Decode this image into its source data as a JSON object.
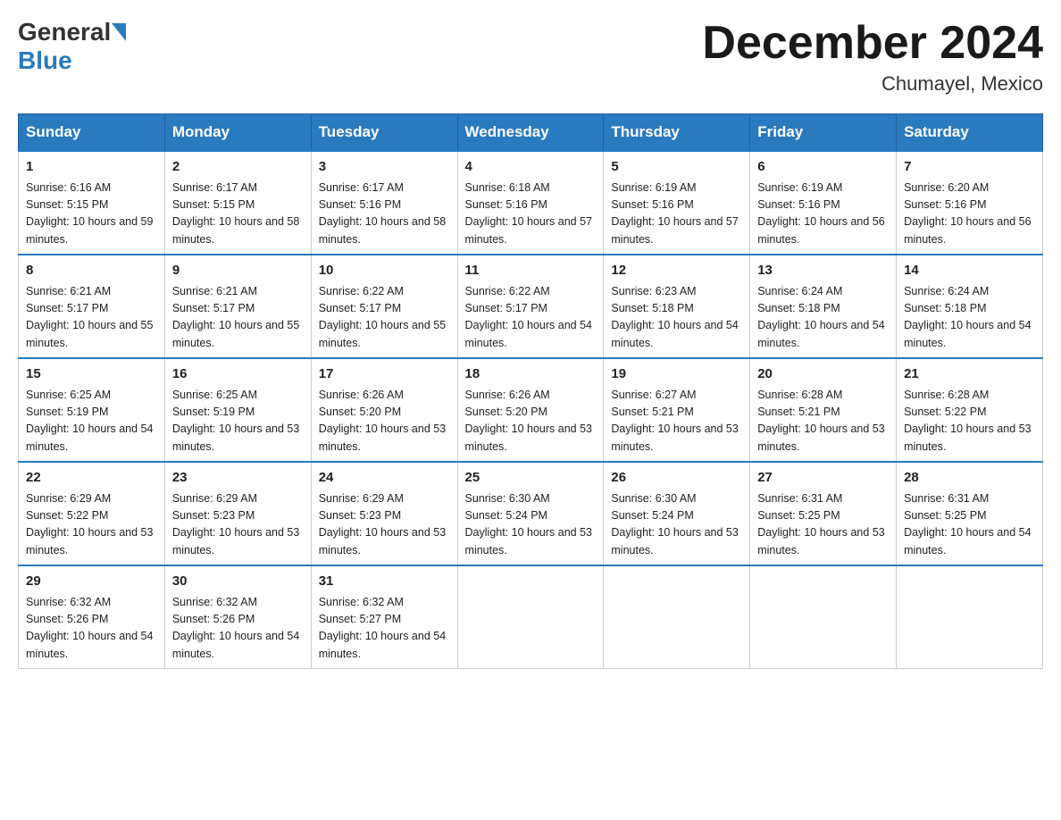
{
  "header": {
    "logo": {
      "general": "General",
      "blue": "Blue"
    },
    "title": "December 2024",
    "location": "Chumayel, Mexico"
  },
  "days_of_week": [
    "Sunday",
    "Monday",
    "Tuesday",
    "Wednesday",
    "Thursday",
    "Friday",
    "Saturday"
  ],
  "weeks": [
    [
      {
        "day": "1",
        "sunrise": "6:16 AM",
        "sunset": "5:15 PM",
        "daylight": "10 hours and 59 minutes."
      },
      {
        "day": "2",
        "sunrise": "6:17 AM",
        "sunset": "5:15 PM",
        "daylight": "10 hours and 58 minutes."
      },
      {
        "day": "3",
        "sunrise": "6:17 AM",
        "sunset": "5:16 PM",
        "daylight": "10 hours and 58 minutes."
      },
      {
        "day": "4",
        "sunrise": "6:18 AM",
        "sunset": "5:16 PM",
        "daylight": "10 hours and 57 minutes."
      },
      {
        "day": "5",
        "sunrise": "6:19 AM",
        "sunset": "5:16 PM",
        "daylight": "10 hours and 57 minutes."
      },
      {
        "day": "6",
        "sunrise": "6:19 AM",
        "sunset": "5:16 PM",
        "daylight": "10 hours and 56 minutes."
      },
      {
        "day": "7",
        "sunrise": "6:20 AM",
        "sunset": "5:16 PM",
        "daylight": "10 hours and 56 minutes."
      }
    ],
    [
      {
        "day": "8",
        "sunrise": "6:21 AM",
        "sunset": "5:17 PM",
        "daylight": "10 hours and 55 minutes."
      },
      {
        "day": "9",
        "sunrise": "6:21 AM",
        "sunset": "5:17 PM",
        "daylight": "10 hours and 55 minutes."
      },
      {
        "day": "10",
        "sunrise": "6:22 AM",
        "sunset": "5:17 PM",
        "daylight": "10 hours and 55 minutes."
      },
      {
        "day": "11",
        "sunrise": "6:22 AM",
        "sunset": "5:17 PM",
        "daylight": "10 hours and 54 minutes."
      },
      {
        "day": "12",
        "sunrise": "6:23 AM",
        "sunset": "5:18 PM",
        "daylight": "10 hours and 54 minutes."
      },
      {
        "day": "13",
        "sunrise": "6:24 AM",
        "sunset": "5:18 PM",
        "daylight": "10 hours and 54 minutes."
      },
      {
        "day": "14",
        "sunrise": "6:24 AM",
        "sunset": "5:18 PM",
        "daylight": "10 hours and 54 minutes."
      }
    ],
    [
      {
        "day": "15",
        "sunrise": "6:25 AM",
        "sunset": "5:19 PM",
        "daylight": "10 hours and 54 minutes."
      },
      {
        "day": "16",
        "sunrise": "6:25 AM",
        "sunset": "5:19 PM",
        "daylight": "10 hours and 53 minutes."
      },
      {
        "day": "17",
        "sunrise": "6:26 AM",
        "sunset": "5:20 PM",
        "daylight": "10 hours and 53 minutes."
      },
      {
        "day": "18",
        "sunrise": "6:26 AM",
        "sunset": "5:20 PM",
        "daylight": "10 hours and 53 minutes."
      },
      {
        "day": "19",
        "sunrise": "6:27 AM",
        "sunset": "5:21 PM",
        "daylight": "10 hours and 53 minutes."
      },
      {
        "day": "20",
        "sunrise": "6:28 AM",
        "sunset": "5:21 PM",
        "daylight": "10 hours and 53 minutes."
      },
      {
        "day": "21",
        "sunrise": "6:28 AM",
        "sunset": "5:22 PM",
        "daylight": "10 hours and 53 minutes."
      }
    ],
    [
      {
        "day": "22",
        "sunrise": "6:29 AM",
        "sunset": "5:22 PM",
        "daylight": "10 hours and 53 minutes."
      },
      {
        "day": "23",
        "sunrise": "6:29 AM",
        "sunset": "5:23 PM",
        "daylight": "10 hours and 53 minutes."
      },
      {
        "day": "24",
        "sunrise": "6:29 AM",
        "sunset": "5:23 PM",
        "daylight": "10 hours and 53 minutes."
      },
      {
        "day": "25",
        "sunrise": "6:30 AM",
        "sunset": "5:24 PM",
        "daylight": "10 hours and 53 minutes."
      },
      {
        "day": "26",
        "sunrise": "6:30 AM",
        "sunset": "5:24 PM",
        "daylight": "10 hours and 53 minutes."
      },
      {
        "day": "27",
        "sunrise": "6:31 AM",
        "sunset": "5:25 PM",
        "daylight": "10 hours and 53 minutes."
      },
      {
        "day": "28",
        "sunrise": "6:31 AM",
        "sunset": "5:25 PM",
        "daylight": "10 hours and 54 minutes."
      }
    ],
    [
      {
        "day": "29",
        "sunrise": "6:32 AM",
        "sunset": "5:26 PM",
        "daylight": "10 hours and 54 minutes."
      },
      {
        "day": "30",
        "sunrise": "6:32 AM",
        "sunset": "5:26 PM",
        "daylight": "10 hours and 54 minutes."
      },
      {
        "day": "31",
        "sunrise": "6:32 AM",
        "sunset": "5:27 PM",
        "daylight": "10 hours and 54 minutes."
      },
      null,
      null,
      null,
      null
    ]
  ]
}
